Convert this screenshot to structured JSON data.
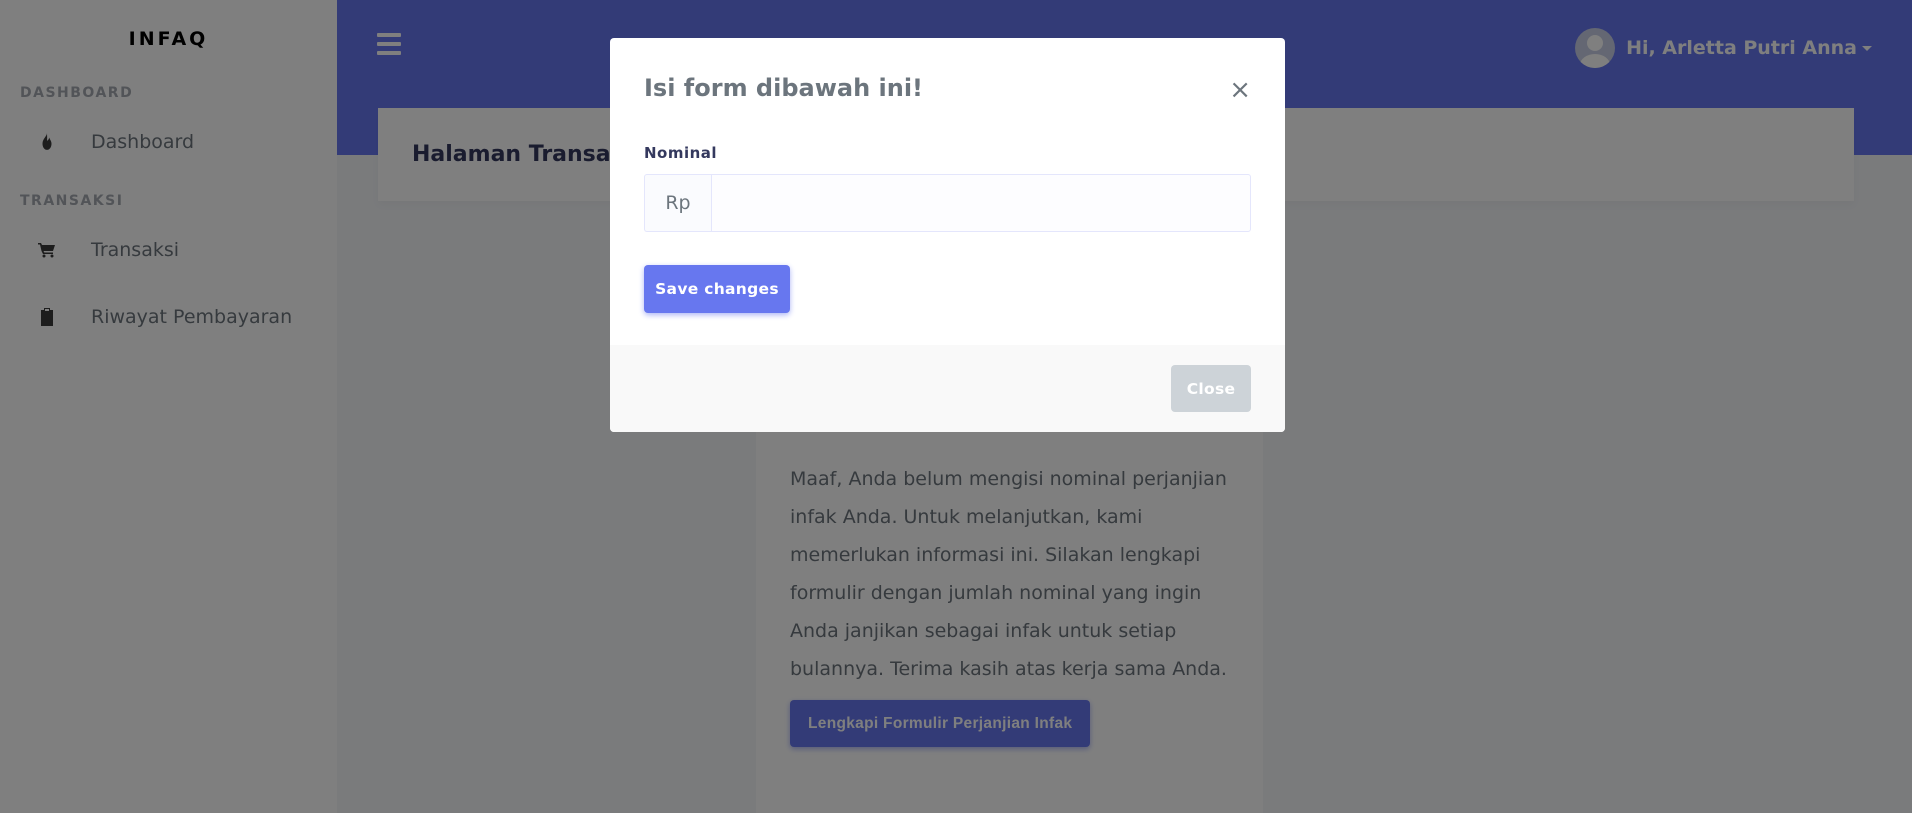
{
  "sidebar": {
    "brand": "INFAQ",
    "sections": [
      {
        "header": "DASHBOARD",
        "items": [
          {
            "label": "Dashboard",
            "icon": "fire-icon"
          }
        ]
      },
      {
        "header": "TRANSAKSI",
        "items": [
          {
            "label": "Transaksi",
            "icon": "cart-icon"
          },
          {
            "label": "Riwayat Pembayaran",
            "icon": "clipboard-check-icon"
          }
        ]
      }
    ]
  },
  "navbar": {
    "menu_icon": "hamburger-icon",
    "user_greeting": "Hi, Arletta Putri Anna"
  },
  "page": {
    "title": "Halaman Transaksi"
  },
  "main_card": {
    "message": "Maaf, Anda belum mengisi nominal perjanjian infak Anda. Untuk melanjutkan, kami memerlukan informasi ini. Silakan lengkapi formulir dengan jumlah nominal yang ingin Anda janjikan sebagai infak untuk setiap bulannya. Terima kasih atas kerja sama Anda.",
    "button_label": "Lengkapi Formulir Perjanjian Infak"
  },
  "modal": {
    "title": "Isi form dibawah ini!",
    "close_symbol": "×",
    "field_label": "Nominal",
    "currency_prefix": "Rp",
    "field_value": "",
    "save_label": "Save changes",
    "close_label": "Close"
  },
  "colors": {
    "primary": "#6777ef",
    "sidebar_bg": "#ffffff",
    "page_bg": "#f4f6f9",
    "close_button": "#cdd3d8"
  }
}
